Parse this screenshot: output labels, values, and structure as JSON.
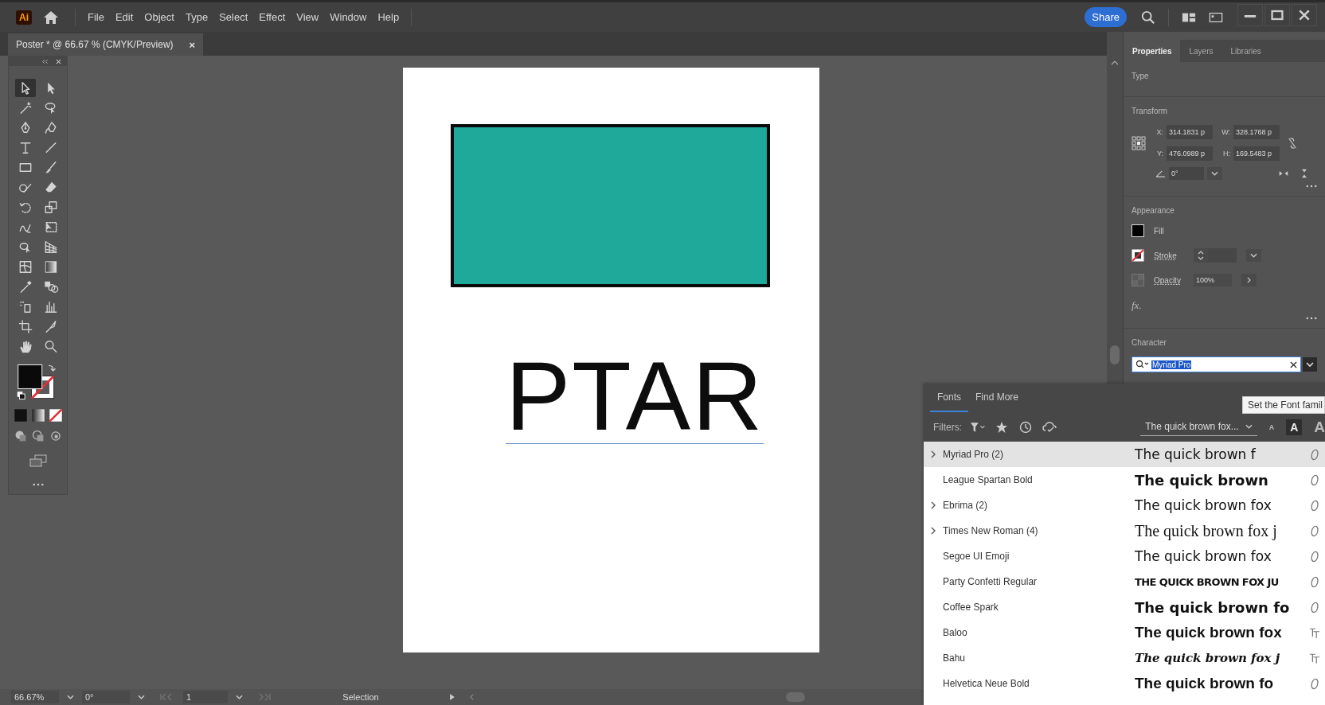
{
  "app": {
    "logo": "Ai",
    "menus": [
      "File",
      "Edit",
      "Object",
      "Type",
      "Select",
      "Effect",
      "View",
      "Window",
      "Help"
    ],
    "share": "Share"
  },
  "document_tab": {
    "title": "Poster * @ 66.67 % (CMYK/Preview)",
    "close": "×"
  },
  "tools": [
    {
      "selected": true
    },
    {
      "selected": false
    },
    {
      "selected": false
    },
    {
      "selected": false
    },
    {
      "selected": false
    },
    {
      "selected": false
    },
    {
      "selected": false
    },
    {
      "selected": false
    },
    {
      "selected": false
    },
    {
      "selected": false
    },
    {
      "selected": false
    },
    {
      "selected": false
    },
    {
      "selected": false
    },
    {
      "selected": false
    },
    {
      "selected": false
    },
    {
      "selected": false
    },
    {
      "selected": false
    },
    {
      "selected": false
    },
    {
      "selected": false
    },
    {
      "selected": false
    },
    {
      "selected": false
    },
    {
      "selected": false
    },
    {
      "selected": false
    },
    {
      "selected": false
    },
    {
      "selected": false
    },
    {
      "selected": false
    },
    {
      "selected": false
    },
    {
      "selected": false
    }
  ],
  "artboard": {
    "text": "PTAR"
  },
  "status_bar": {
    "zoom": "66.67%",
    "rotation": "0°",
    "artboard": "1",
    "tool": "Selection"
  },
  "properties": {
    "tabs": [
      {
        "label": "Properties",
        "selected": true
      },
      {
        "label": "Layers",
        "selected": false
      },
      {
        "label": "Libraries",
        "selected": false
      }
    ],
    "section_type": "Type",
    "transform": {
      "title": "Transform",
      "fields": [
        {
          "label": "X:",
          "value": "314.1831 p"
        },
        {
          "label": "W:",
          "value": "328.1768 p"
        },
        {
          "label": "Y:",
          "value": "476.0989 p"
        },
        {
          "label": "H:",
          "value": "169.5483 p"
        }
      ],
      "angle": "0°"
    },
    "appearance": {
      "title": "Appearance",
      "fill": "Fill",
      "stroke": "Stroke",
      "opacity_label": "Opacity",
      "opacity": "100%",
      "effects": "fx."
    },
    "character": {
      "title": "Character",
      "font": "Myriad Pro"
    }
  },
  "font_menu": {
    "tabs": [
      {
        "label": "Fonts",
        "selected": true
      },
      {
        "label": "Find More",
        "selected": false
      }
    ],
    "filters_label": "Filters:",
    "sample_text": "The quick brown fox...",
    "sizes": [
      {
        "label": "A",
        "selected": false
      },
      {
        "label": "A",
        "selected": true
      },
      {
        "label": "A",
        "selected": false
      }
    ],
    "fonts": [
      {
        "name": "Myriad Pro (2)",
        "expandable": true,
        "selected": true,
        "sample": "The quick brown f",
        "kind": "regular",
        "truetype": false
      },
      {
        "name": "League Spartan Bold",
        "expandable": false,
        "selected": false,
        "sample": "The quick brown",
        "kind": "heavy",
        "truetype": false
      },
      {
        "name": "Ebrima (2)",
        "expandable": true,
        "selected": false,
        "sample": "The quick brown fox",
        "kind": "regular",
        "truetype": false
      },
      {
        "name": "Times New Roman (4)",
        "expandable": true,
        "selected": false,
        "sample": "The quick brown fox j",
        "kind": "serif",
        "truetype": false
      },
      {
        "name": "Segoe UI Emoji",
        "expandable": false,
        "selected": false,
        "sample": "The quick brown fox",
        "kind": "regular",
        "truetype": false
      },
      {
        "name": "Party Confetti Regular",
        "expandable": false,
        "selected": false,
        "sample": "THE QUICK BROWN FOX JU",
        "kind": "condensed",
        "truetype": false
      },
      {
        "name": "Coffee Spark",
        "expandable": false,
        "selected": false,
        "sample": "The quick brown fo",
        "kind": "heavy",
        "truetype": false
      },
      {
        "name": "Baloo",
        "expandable": false,
        "selected": false,
        "sample": "The quick brown fox",
        "kind": "bold",
        "truetype": true
      },
      {
        "name": "Bahu",
        "expandable": false,
        "selected": false,
        "sample": "The quick brown fox j",
        "kind": "script",
        "truetype": true
      },
      {
        "name": "Helvetica Neue Bold",
        "expandable": false,
        "selected": false,
        "sample": "The quick brown fo",
        "kind": "bold",
        "truetype": false
      }
    ]
  },
  "tooltip": "Set the Font famil"
}
